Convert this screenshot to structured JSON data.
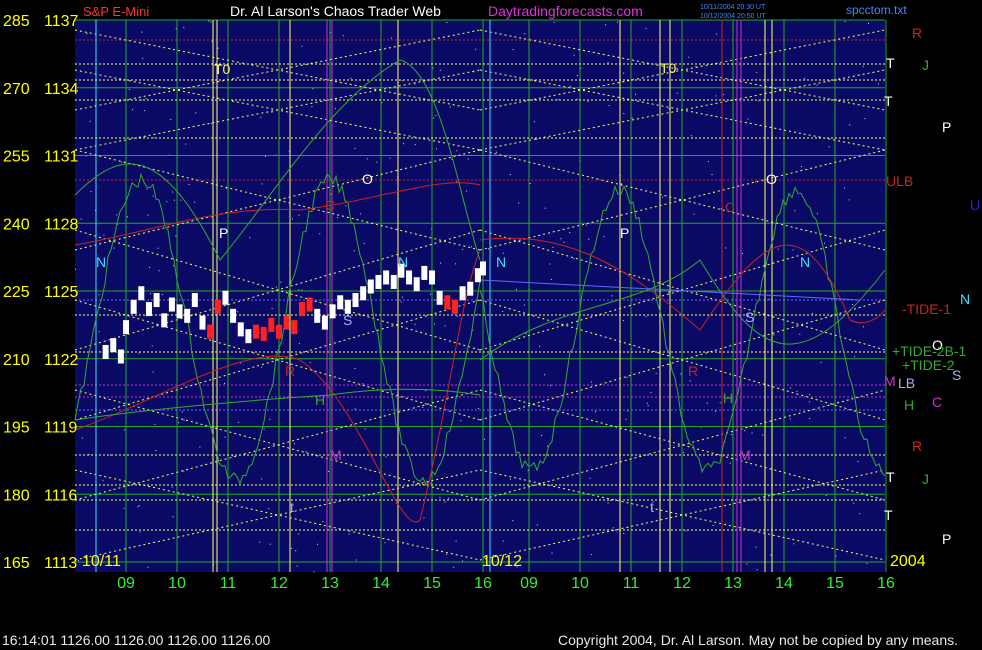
{
  "header": {
    "instrument": "S&P E-Mini",
    "site": "Dr. Al Larson's Chaos Trader Web",
    "url": "Daytradingforecasts.com",
    "stamp_line1": "10/11/2004 20:30 UT",
    "stamp_line2": "10/12/2004 20:50 UT",
    "file": "spcctom.txt"
  },
  "footer": {
    "left": "16:14:01  1126.00 1126.00 1126.00 1126.00",
    "right": "Copyright 2004, Dr. Al Larson. May not be copied by any means."
  },
  "colors": {
    "background": "#000000",
    "plot_bg": "#0a0a66",
    "grid_green": "#22aa22",
    "yellow": "#ffff66",
    "red": "#cc2222",
    "green_line": "#33aa33",
    "cyan": "#44ddff",
    "magenta": "#cc33cc",
    "price_white": "#ffffff",
    "price_red": "#ff2222",
    "axis_yellow": "#ffff00",
    "axis_green": "#33ee33"
  },
  "chart_data": {
    "type": "line",
    "y_axis_left_labels": [
      {
        "score": 285,
        "price": 1137
      },
      {
        "score": 270,
        "price": 1134
      },
      {
        "score": 255,
        "price": 1131
      },
      {
        "score": 240,
        "price": 1128
      },
      {
        "score": 225,
        "price": 1125
      },
      {
        "score": 210,
        "price": 1122
      },
      {
        "score": 195,
        "price": 1119
      },
      {
        "score": 180,
        "price": 1116
      },
      {
        "score": 165,
        "price": 1113
      }
    ],
    "ylim": [
      1113,
      1137
    ],
    "x_tick_labels": [
      "09",
      "10",
      "11",
      "12",
      "13",
      "14",
      "15",
      "16",
      "09",
      "10",
      "11",
      "12",
      "13",
      "14",
      "15",
      "16"
    ],
    "date_labels": [
      "10/11",
      "10/12",
      "2004"
    ],
    "price_series": {
      "name": "S&P E-Mini",
      "x_hours": [
        8.6,
        8.75,
        8.9,
        9.0,
        9.15,
        9.3,
        9.45,
        9.6,
        9.75,
        9.9,
        10.05,
        10.2,
        10.35,
        10.5,
        10.65,
        10.8,
        10.95,
        11.1,
        11.25,
        11.4,
        11.55,
        11.7,
        11.85,
        12.0,
        12.15,
        12.3,
        12.45,
        12.6,
        12.75,
        12.9,
        13.05,
        13.2,
        13.35,
        13.5,
        13.65,
        13.8,
        13.95,
        14.1,
        14.25,
        14.4,
        14.55,
        14.7,
        14.85,
        15.0,
        15.15,
        15.3,
        15.45,
        15.6,
        15.75,
        15.9,
        16.0
      ],
      "values": [
        1122.3,
        1122.6,
        1122.1,
        1123.4,
        1124.3,
        1124.9,
        1124.2,
        1124.6,
        1123.7,
        1124.4,
        1124.1,
        1123.9,
        1124.6,
        1123.6,
        1123.2,
        1124.3,
        1124.7,
        1123.9,
        1123.3,
        1123.0,
        1123.2,
        1123.1,
        1123.5,
        1123.2,
        1123.6,
        1123.4,
        1124.2,
        1124.4,
        1123.9,
        1123.6,
        1124.1,
        1124.5,
        1124.3,
        1124.6,
        1124.9,
        1125.2,
        1125.4,
        1125.6,
        1125.4,
        1125.9,
        1125.6,
        1125.3,
        1125.8,
        1125.6,
        1124.7,
        1124.5,
        1124.3,
        1124.9,
        1125.1,
        1125.7,
        1126.0
      ],
      "red_segments": [
        [
          10.6,
          10.8
        ],
        [
          11.5,
          12.6
        ],
        [
          15.2,
          15.5
        ]
      ]
    },
    "forecast_lines_right_labels": [
      {
        "text": "R",
        "color": "#cc2222"
      },
      {
        "text": "T",
        "color": "#ffffff"
      },
      {
        "text": "J",
        "color": "#33aa33"
      },
      {
        "text": "T",
        "color": "#ffffff"
      },
      {
        "text": "P",
        "color": "#ffffff"
      },
      {
        "text": "ULB",
        "color": "#cc2222"
      },
      {
        "text": "U",
        "color": "#2222cc"
      },
      {
        "text": "-TIDE-1",
        "color": "#cc2222"
      },
      {
        "text": "N",
        "color": "#44ddff"
      },
      {
        "text": "O",
        "color": "#ffffff"
      },
      {
        "text": "+TIDE-2B-1",
        "color": "#33aa33"
      },
      {
        "text": "+TIDE-2",
        "color": "#33aa33"
      },
      {
        "text": "S",
        "color": "#aaaaff"
      },
      {
        "text": "M",
        "color": "#cc33cc"
      },
      {
        "text": "LB",
        "color": "#aaaaff"
      },
      {
        "text": "H",
        "color": "#33aa33"
      },
      {
        "text": "C",
        "color": "#cc33cc"
      },
      {
        "text": "R",
        "color": "#cc2222"
      },
      {
        "text": "T",
        "color": "#ffffff"
      },
      {
        "text": "J",
        "color": "#33aa33"
      },
      {
        "text": "T",
        "color": "#ffffff"
      },
      {
        "text": "P",
        "color": "#ffffff"
      }
    ],
    "in_chart_letters": [
      {
        "text": "T0",
        "color": "#ffff66"
      },
      {
        "text": "T0",
        "color": "#ffff66"
      },
      {
        "text": "P",
        "color": "#ffffff"
      },
      {
        "text": "P",
        "color": "#ffffff"
      },
      {
        "text": "O",
        "color": "#ffffff"
      },
      {
        "text": "O",
        "color": "#ffffff"
      },
      {
        "text": "C",
        "color": "#cc2222"
      },
      {
        "text": "C",
        "color": "#cc2222"
      },
      {
        "text": "N",
        "color": "#44ddff"
      },
      {
        "text": "N",
        "color": "#44ddff"
      },
      {
        "text": "N",
        "color": "#44ddff"
      },
      {
        "text": "N",
        "color": "#44ddff"
      },
      {
        "text": "S",
        "color": "#aaaaff"
      },
      {
        "text": "S",
        "color": "#aaaaff"
      },
      {
        "text": "R",
        "color": "#cc2222"
      },
      {
        "text": "R",
        "color": "#cc2222"
      },
      {
        "text": "H",
        "color": "#33aa33"
      },
      {
        "text": "H",
        "color": "#33aa33"
      },
      {
        "text": "M",
        "color": "#cc33cc"
      },
      {
        "text": "M",
        "color": "#cc33cc"
      },
      {
        "text": "t",
        "color": "#aaaaff"
      },
      {
        "text": "t",
        "color": "#aaaaff"
      }
    ],
    "grid": true
  }
}
